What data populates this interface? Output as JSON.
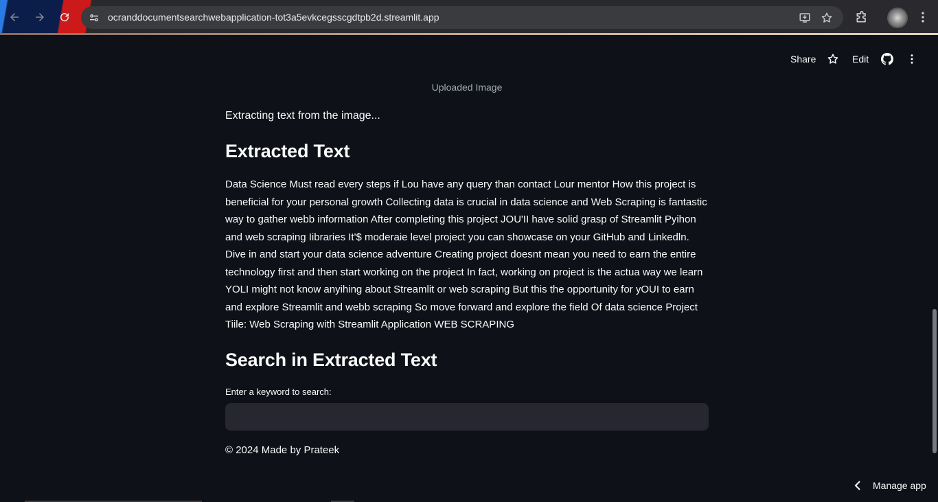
{
  "browser": {
    "url": "ocranddocumentsearchwebapplication-tot3a5evkcegsscgdtpb2d.streamlit.app",
    "icons": [
      "back-icon",
      "forward-icon",
      "reload-icon",
      "site-info-icon",
      "install-app-icon",
      "bookmark-star-icon",
      "extensions-icon",
      "profile-avatar",
      "browser-menu-icon"
    ]
  },
  "header": {
    "share_label": "Share",
    "edit_label": "Edit",
    "icons": [
      "star-icon",
      "github-icon",
      "more-menu-icon"
    ]
  },
  "main": {
    "image_caption": "Uploaded Image",
    "status_text": "Extracting text from the image...",
    "extracted_heading": "Extracted Text",
    "extracted_text": "Data Science Must read every steps if Lou have any query than contact Lour mentor How this project is beneficial for your personal growth Collecting data is crucial in data science and Web Scraping is fantastic way to gather webb information After completing this project JOU'II have solid grasp of Streamlit Pyihon and web scraping Iibraries It'$ moderaie level project you can showcase on your GitHub and Linkedln. Dive in and start your data science adventure Creating project doesnt mean you need to earn the entire technology first and then start working on the project In fact, working on project is the actua way we learn YOLI might not know anyihing about Streamlit or web scraping But this the opportunity for yOUI to earn and explore Streamlit and webb scraping So move forward and explore the field Of data science Project Tiile: Web Scraping with Streamlit Application WEB SCRAPING",
    "search_heading": "Search in Extracted Text",
    "search_label": "Enter a keyword to search:",
    "search_value": "",
    "footer": "© 2024 Made by Prateek"
  },
  "manage_app": {
    "label": "Manage app"
  },
  "colors": {
    "background": "#0e1117",
    "input_bg": "#262730",
    "text": "#fafafa",
    "caption": "#a3a8b4"
  }
}
